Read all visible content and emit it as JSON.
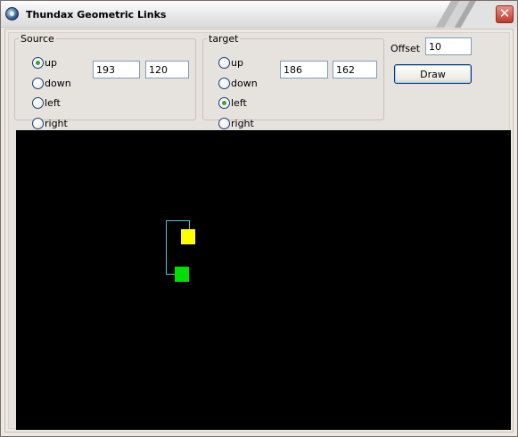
{
  "window": {
    "title": "Thundax Geometric Links",
    "close_glyph": "✕"
  },
  "source": {
    "legend": "Source",
    "options": [
      "up",
      "down",
      "left",
      "right"
    ],
    "selected": "up",
    "x": "193",
    "y": "120"
  },
  "target": {
    "legend": "target",
    "options": [
      "up",
      "down",
      "left",
      "right"
    ],
    "selected": "left",
    "x": "186",
    "y": "162"
  },
  "offset": {
    "label": "Offset",
    "value": "10"
  },
  "draw_button": {
    "label": "Draw"
  },
  "canvas": {
    "background": "#000000",
    "link_color": "#4cc7d9",
    "source_box_color": "#ffff00",
    "target_box_color": "#00e000"
  }
}
